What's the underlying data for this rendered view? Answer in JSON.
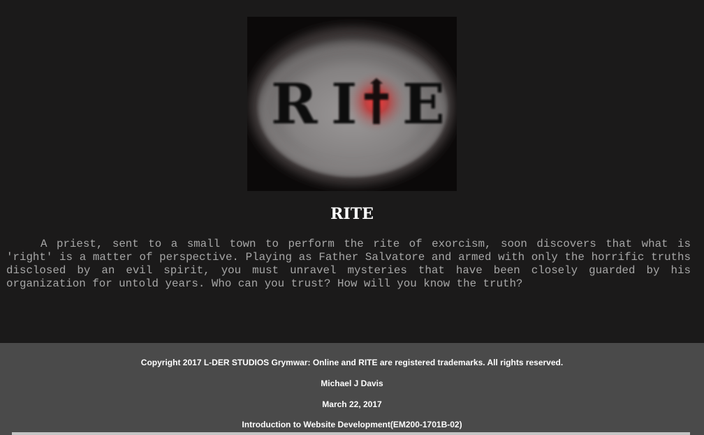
{
  "logo": {
    "letters": [
      "R",
      "I",
      "E"
    ],
    "icon": "cross-icon",
    "colors": {
      "background": "#0b0909",
      "plate": "#8a8787",
      "glow": "#d02a2a"
    }
  },
  "game": {
    "title": "RITE",
    "description": "A priest, sent to a small town to perform the rite of exorcism, soon discovers that what is 'right' is a matter of perspective. Playing as Father Salvatore and armed with only the horrific truths disclosed by an evil spirit, you must unravel mysteries that have been closely guarded by his organization for untold years. Who can you trust? How will you know the truth?"
  },
  "footer": {
    "copyright": "Copyright 2017 L-DER STUDIOS Grymwar: Online and RITE are registered trademarks. All rights reserved.",
    "author": "Michael J Davis",
    "date": "March 22, 2017",
    "course": "Introduction to Website Development(EM200-1701B-02)"
  },
  "colors": {
    "page_background": "#1b1a1a",
    "footer_background": "#4a4a4a",
    "text_muted": "#a7a7a7",
    "text_white": "#ffffff"
  }
}
